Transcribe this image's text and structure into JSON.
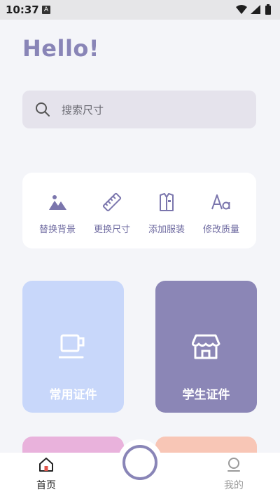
{
  "status_bar": {
    "time": "10:37",
    "app_badge": "A"
  },
  "greeting": "Hello!",
  "search": {
    "placeholder": "搜索尺寸"
  },
  "tools": [
    {
      "label": "替换背景",
      "icon": "landscape-icon"
    },
    {
      "label": "更换尺寸",
      "icon": "ruler-icon"
    },
    {
      "label": "添加服装",
      "icon": "clothing-icon"
    },
    {
      "label": "修改质量",
      "icon": "text-font-icon"
    }
  ],
  "cards": [
    {
      "label": "常用证件",
      "icon": "cup-icon",
      "color": "#c8d7fa"
    },
    {
      "label": "学生证件",
      "icon": "store-icon",
      "color": "#8b86b6"
    }
  ],
  "peek_cards": [
    {
      "color": "#e9b2dc"
    },
    {
      "color": "#f8c6b6"
    }
  ],
  "nav": {
    "home_label": "首页",
    "me_label": "我的"
  },
  "colors": {
    "accent": "#8985b7",
    "background": "#f4f5f9"
  }
}
